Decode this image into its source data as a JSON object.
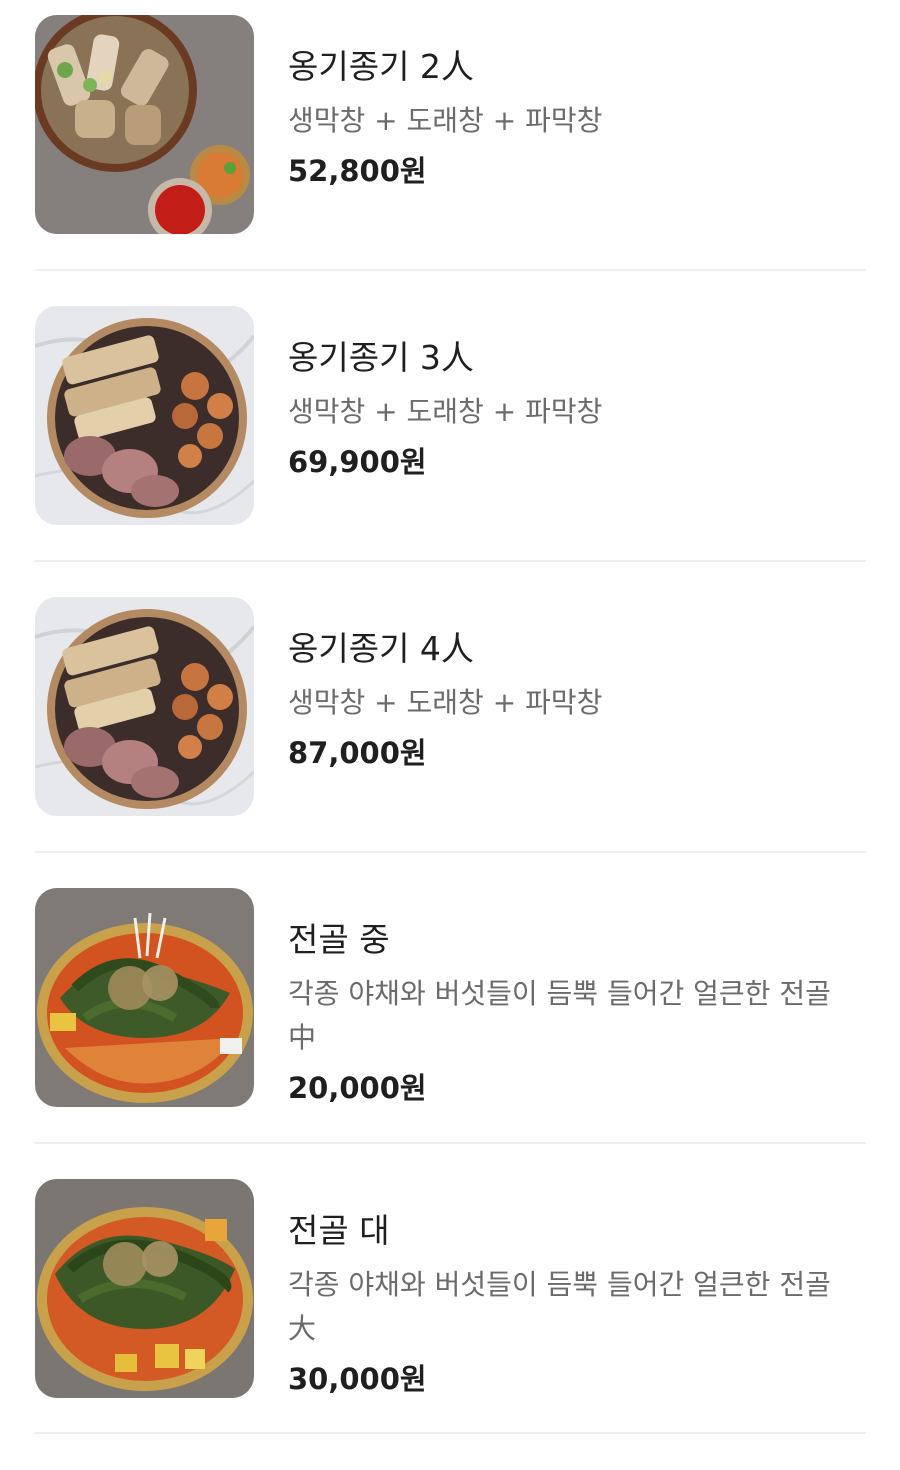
{
  "menu": {
    "items": [
      {
        "name": "옹기종기 2人",
        "description": "생막창 + 도래창 + 파막창",
        "price": "52,800원",
        "image": "food-photo"
      },
      {
        "name": "옹기종기 3人",
        "description": "생막창 + 도래창 + 파막창",
        "price": "69,900원",
        "image": "food-photo"
      },
      {
        "name": "옹기종기 4人",
        "description": "생막창 + 도래창 + 파막창",
        "price": "87,000원",
        "image": "food-photo"
      },
      {
        "name": "전골 중",
        "description": "각종 야채와 버섯들이 듬뿍 들어간 얼큰한 전골 中",
        "price": "20,000원",
        "image": "food-photo"
      },
      {
        "name": "전골 대",
        "description": "각종 야채와 버섯들이 듬뿍 들어간 얼큰한 전골 大",
        "price": "30,000원",
        "image": "food-photo"
      }
    ]
  }
}
